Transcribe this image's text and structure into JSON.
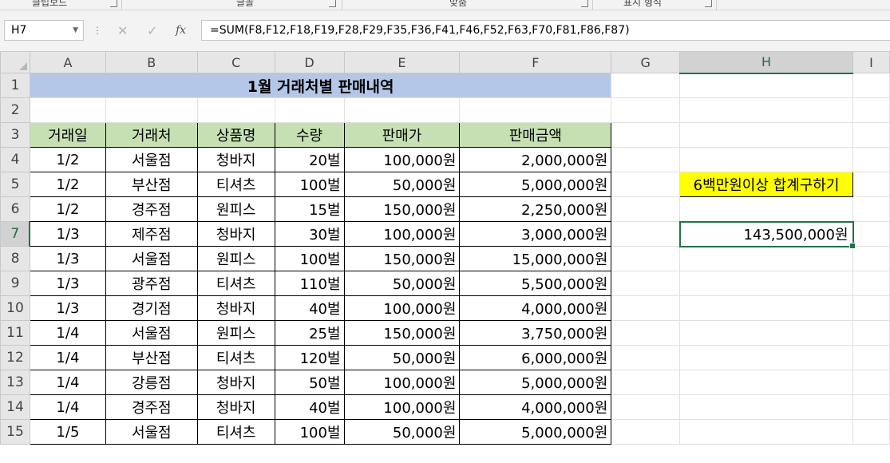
{
  "ribbon": {
    "groups": [
      "클립보드",
      "글꼴",
      "맞춤",
      "표시 형식"
    ]
  },
  "formula_bar": {
    "name_box": "H7",
    "fx_label": "fx",
    "cancel_icon": "✕",
    "enter_icon": "✓",
    "formula": "=SUM(F8,F12,F18,F19,F28,F29,F35,F36,F41,F46,F52,F63,F70,F81,F86,F87)"
  },
  "columns": [
    "A",
    "B",
    "C",
    "D",
    "E",
    "F",
    "G",
    "H",
    "I"
  ],
  "row_numbers": [
    "1",
    "2",
    "3",
    "4",
    "5",
    "6",
    "7",
    "8",
    "9",
    "10",
    "11",
    "12",
    "13",
    "14",
    "15"
  ],
  "sheet": {
    "title": "1월 거래처별 판매내역",
    "headers": [
      "거래일",
      "거래처",
      "상품명",
      "수량",
      "판매가",
      "판매금액"
    ],
    "rows": [
      [
        "1/2",
        "서울점",
        "청바지",
        "20벌",
        "100,000원",
        "2,000,000원"
      ],
      [
        "1/2",
        "부산점",
        "티셔츠",
        "100벌",
        "50,000원",
        "5,000,000원"
      ],
      [
        "1/2",
        "경주점",
        "원피스",
        "15벌",
        "150,000원",
        "2,250,000원"
      ],
      [
        "1/3",
        "제주점",
        "청바지",
        "30벌",
        "100,000원",
        "3,000,000원"
      ],
      [
        "1/3",
        "서울점",
        "원피스",
        "100벌",
        "150,000원",
        "15,000,000원"
      ],
      [
        "1/3",
        "광주점",
        "티셔츠",
        "110벌",
        "50,000원",
        "5,500,000원"
      ],
      [
        "1/3",
        "경기점",
        "청바지",
        "40벌",
        "100,000원",
        "4,000,000원"
      ],
      [
        "1/4",
        "서울점",
        "원피스",
        "25벌",
        "150,000원",
        "3,750,000원"
      ],
      [
        "1/4",
        "부산점",
        "티셔츠",
        "120벌",
        "50,000원",
        "6,000,000원"
      ],
      [
        "1/4",
        "강릉점",
        "청바지",
        "50벌",
        "100,000원",
        "5,000,000원"
      ],
      [
        "1/4",
        "경주점",
        "청바지",
        "40벌",
        "100,000원",
        "4,000,000원"
      ],
      [
        "1/5",
        "서울점",
        "티셔츠",
        "100벌",
        "50,000원",
        "5,000,000원"
      ]
    ],
    "task_label": "6백만원이상 합계구하기",
    "result_value": "143,500,000원"
  },
  "colors": {
    "title_fill": "#b4c7e7",
    "header_fill": "#c6e0b4",
    "task_fill": "#ffff00",
    "selection": "#217346"
  },
  "selected_cell": "H7"
}
